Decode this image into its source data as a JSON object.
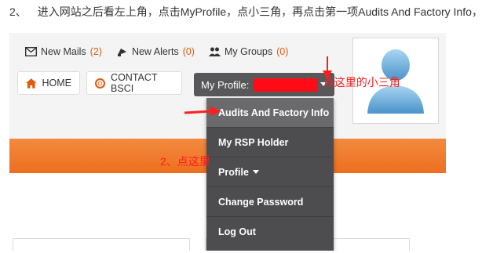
{
  "instruction": {
    "number": "2、",
    "text": "进入网站之后看左上角，点击MyProfile，点小三角，再点击第一项Audits And Factory Info，"
  },
  "toplinks": [
    {
      "label": "New Mails",
      "count": "(2)",
      "icon": "mail-icon"
    },
    {
      "label": "New Alerts",
      "count": "(0)",
      "icon": "alert-icon"
    },
    {
      "label": "My Groups",
      "count": "(0)",
      "icon": "groups-icon"
    }
  ],
  "nav": {
    "home_label": "HOME",
    "contact_label": "CONTACT BSCI",
    "profile_label": "My Profile:"
  },
  "dropdown": {
    "items": [
      {
        "label": "Audits And Factory Info"
      },
      {
        "label": "My RSP Holder"
      },
      {
        "label": "Profile"
      },
      {
        "label": "Change Password"
      },
      {
        "label": "Log Out"
      }
    ]
  },
  "annotations": {
    "step1": "1、点这里的小三角",
    "step2": "2、点这里"
  },
  "colors": {
    "accent_orange": "#ee6f1f",
    "annotation_red": "#ff1d1d",
    "dropdown_bg": "#4d4d4f",
    "redaction": "#ff0a16"
  }
}
